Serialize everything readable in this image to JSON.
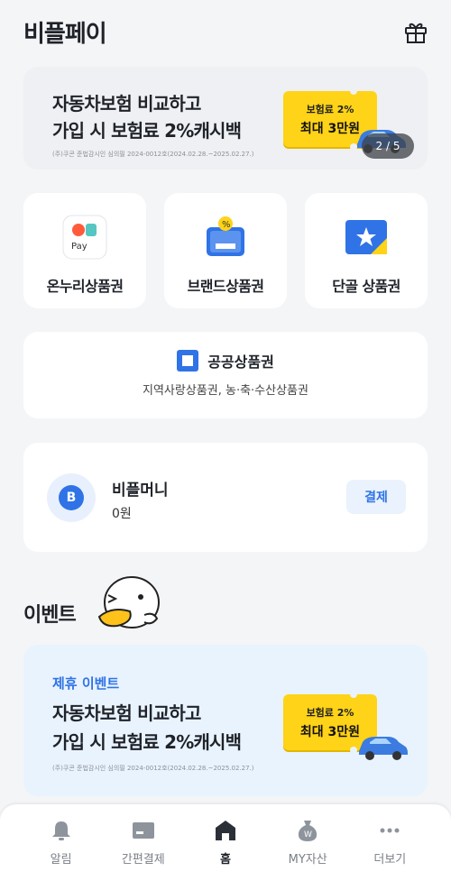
{
  "header": {
    "title": "비플페이",
    "gift_icon": "gift-icon"
  },
  "top_banner": {
    "title_line1": "자동차보험 비교하고",
    "title_line2": "가입 시 보험료 2%캐시백",
    "note": "(주)쿠콘 준법감시인 심의필 2024-0012호(2024.02.28.~2025.02.27.)",
    "ticket_line1": "보험료 2%",
    "ticket_line2": "최대 3만원",
    "pager": "2 / 5"
  },
  "vouchers": [
    {
      "label": "온누리상품권",
      "icon": "onnuri-pay-icon"
    },
    {
      "label": "브랜드상품권",
      "icon": "brand-voucher-icon"
    },
    {
      "label": "단골 상품권",
      "icon": "star-card-icon"
    }
  ],
  "public_voucher": {
    "title": "공공상품권",
    "subtitle": "지역사랑상품권, 농·축·수산상품권"
  },
  "money": {
    "avatar_letter": "B",
    "name": "비플머니",
    "balance": "0원",
    "pay_label": "결제"
  },
  "event": {
    "section_title": "이벤트",
    "tag": "제휴 이벤트",
    "title_line1": "자동차보험 비교하고",
    "title_line2": "가입 시 보험료 2%캐시백",
    "note": "(주)쿠콘 준법감시인 심의필 2024-0012호(2024.02.28.~2025.02.27.)",
    "ticket_line1": "보험료 2%",
    "ticket_line2": "최대 3만원"
  },
  "tabs": [
    {
      "label": "알림",
      "icon": "bell-icon"
    },
    {
      "label": "간편결제",
      "icon": "card-icon"
    },
    {
      "label": "홈",
      "icon": "home-icon",
      "active": true
    },
    {
      "label": "MY자산",
      "icon": "money-bag-icon"
    },
    {
      "label": "더보기",
      "icon": "more-dots-icon"
    }
  ],
  "colors": {
    "accent": "#2f73e6",
    "ticket": "#ffd317",
    "background": "#f4f5f7"
  }
}
